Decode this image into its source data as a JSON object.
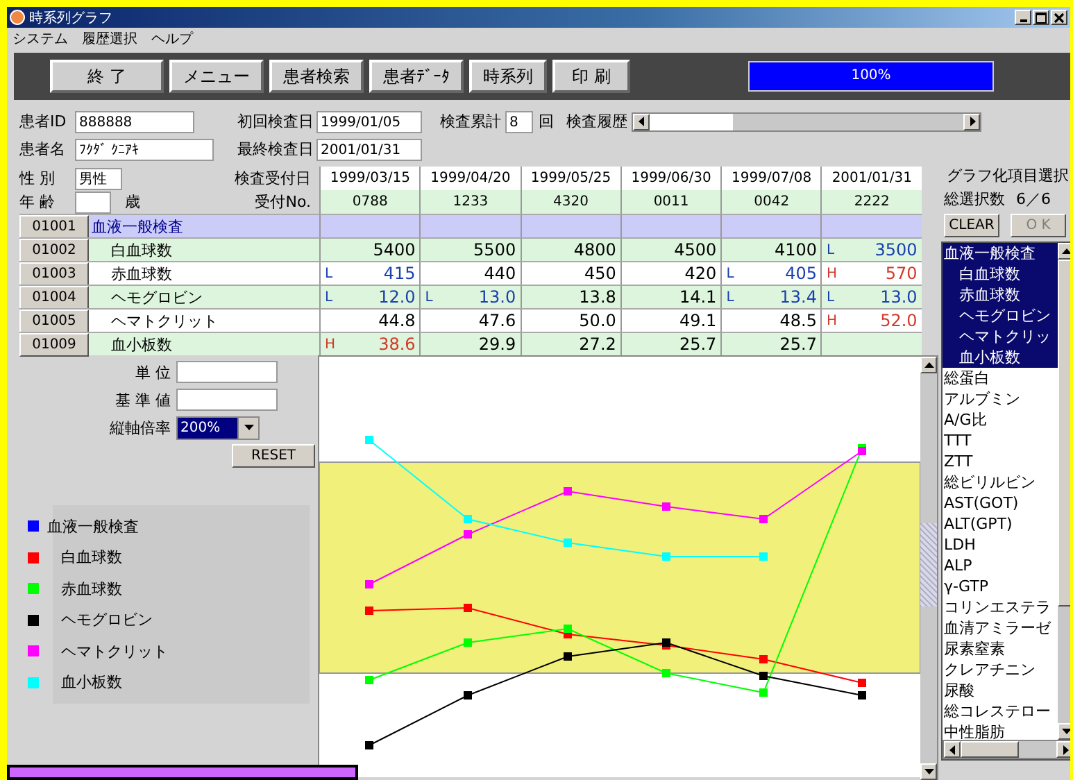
{
  "window": {
    "title": "時系列グラフ"
  },
  "menu": [
    "システム",
    "履歴選択",
    "ヘルプ"
  ],
  "toolbar": {
    "buttons": [
      "終 了",
      "メニュー",
      "患者検索",
      "患者ﾃﾞｰﾀ",
      "時系列",
      "印 刷"
    ],
    "progress": {
      "level": 1,
      "label": "100%"
    }
  },
  "patient": {
    "id_label": "患者ID",
    "id": "888888",
    "name_label": "患者名",
    "name": "ﾌｸﾀﾞ ｸﾆｱｷ",
    "first_label": "初回検査日",
    "first": "1999/01/05",
    "last_label": "最終検査日",
    "last": "2001/01/31",
    "count_label": "検査累計",
    "count": "8",
    "count_unit": "回",
    "history_label": "検査履歴",
    "sex_label": "性 別",
    "sex": "男性",
    "age_label": "年 齢",
    "age_unit": "歳"
  },
  "table": {
    "date_label": "検査受付日",
    "number_label": "受付No.",
    "columns": [
      {
        "date": "1999/03/15",
        "number": "0788"
      },
      {
        "date": "1999/04/20",
        "number": "1233"
      },
      {
        "date": "1999/05/25",
        "number": "4320"
      },
      {
        "date": "1999/06/30",
        "number": "0011"
      },
      {
        "date": "1999/07/08",
        "number": "0042"
      },
      {
        "date": "2001/01/31",
        "number": "2222"
      }
    ],
    "rows": [
      {
        "code": "01001",
        "name": "血液一般検査",
        "kind": "group",
        "cells": []
      },
      {
        "code": "01002",
        "name": "白血球数",
        "kind": "item",
        "cells": [
          {
            "value": "5400",
            "color": "#000000"
          },
          {
            "value": "5500",
            "color": "#000000"
          },
          {
            "value": "4800",
            "color": "#000000"
          },
          {
            "value": "4500",
            "color": "#000000"
          },
          {
            "value": "4100",
            "color": "#000000"
          },
          {
            "flag": "L",
            "value": "3500",
            "color": "#1a3fb0"
          }
        ]
      },
      {
        "code": "01003",
        "name": "赤血球数",
        "kind": "item",
        "cells": [
          {
            "flag": "L",
            "value": "415",
            "color": "#1a3fb0"
          },
          {
            "value": "440",
            "color": "#000000"
          },
          {
            "value": "450",
            "color": "#000000"
          },
          {
            "value": "420",
            "color": "#000000"
          },
          {
            "flag": "L",
            "value": "405",
            "color": "#1a3fb0"
          },
          {
            "flag": "H",
            "value": "570",
            "color": "#d23a2a"
          }
        ]
      },
      {
        "code": "01004",
        "name": "ヘモグロビン",
        "kind": "item",
        "cells": [
          {
            "flag": "L",
            "value": "12.0",
            "color": "#1a3fb0"
          },
          {
            "flag": "L",
            "value": "13.0",
            "color": "#1a3fb0"
          },
          {
            "value": "13.8",
            "color": "#000000"
          },
          {
            "value": "14.1",
            "color": "#000000"
          },
          {
            "flag": "L",
            "value": "13.4",
            "color": "#1a3fb0"
          },
          {
            "flag": "L",
            "value": "13.0",
            "color": "#1a3fb0"
          }
        ]
      },
      {
        "code": "01005",
        "name": "ヘマトクリット",
        "kind": "item",
        "cells": [
          {
            "value": "44.8",
            "color": "#000000"
          },
          {
            "value": "47.6",
            "color": "#000000"
          },
          {
            "value": "50.0",
            "color": "#000000"
          },
          {
            "value": "49.1",
            "color": "#000000"
          },
          {
            "value": "48.5",
            "color": "#000000"
          },
          {
            "flag": "H",
            "value": "52.0",
            "color": "#d23a2a"
          }
        ]
      },
      {
        "code": "01009",
        "name": "血小板数",
        "kind": "item",
        "cells": [
          {
            "flag": "H",
            "value": "38.6",
            "color": "#d23a2a"
          },
          {
            "value": "29.9",
            "color": "#000000"
          },
          {
            "value": "27.2",
            "color": "#000000"
          },
          {
            "value": "25.7",
            "color": "#000000"
          },
          {
            "value": "25.7",
            "color": "#000000"
          }
        ]
      }
    ]
  },
  "settings": {
    "unit_label": "単 位",
    "reference_label": "基 準 値",
    "scale_label": "縦軸倍率",
    "scale": "200%",
    "reset": "RESET"
  },
  "legend": [
    {
      "name": "血液一般検査",
      "color": "#0000ff",
      "children": [
        {
          "name": "白血球数",
          "color": "#ff0000"
        },
        {
          "name": "赤血球数",
          "color": "#00ff00"
        },
        {
          "name": "ヘモグロビン",
          "color": "#000000"
        },
        {
          "name": "ヘマトクリット",
          "color": "#ff00ff"
        },
        {
          "name": "血小板数",
          "color": "#00ffff"
        }
      ]
    }
  ],
  "selector": {
    "title": "グラフ化項目選択",
    "count_label": "総選択数",
    "count": "6／6",
    "clear": "CLEAR",
    "ok": {
      "label": "O K",
      "disabled": true
    },
    "items": [
      {
        "name": "血液一般検査",
        "selected": true,
        "children": [
          {
            "name": "白血球数",
            "selected": true
          },
          {
            "name": "赤血球数",
            "selected": true
          },
          {
            "name": "ヘモグロビン",
            "selected": true
          },
          {
            "name": "ヘマトクリッ",
            "selected": true
          },
          {
            "name": "血小板数",
            "selected": true
          }
        ]
      },
      {
        "name": "総蛋白",
        "selected": false
      },
      {
        "name": "アルブミン",
        "selected": false
      },
      {
        "name": "A/G比",
        "selected": false
      },
      {
        "name": "TTT",
        "selected": false
      },
      {
        "name": "ZTT",
        "selected": false
      },
      {
        "name": "総ビリルビン",
        "selected": false
      },
      {
        "name": "AST(GOT)",
        "selected": false
      },
      {
        "name": "ALT(GPT)",
        "selected": false
      },
      {
        "name": "LDH",
        "selected": false
      },
      {
        "name": "ALP",
        "selected": false
      },
      {
        "name": "γ-GTP",
        "selected": false
      },
      {
        "name": "コリンエステラ",
        "selected": false
      },
      {
        "name": "血清アミラーゼ",
        "selected": false
      },
      {
        "name": "尿素窒素",
        "selected": false
      },
      {
        "name": "クレアチニン",
        "selected": false
      },
      {
        "name": "尿酸",
        "selected": false
      },
      {
        "name": "総コレステロー",
        "selected": false
      },
      {
        "name": "中性脂肪",
        "selected": false
      }
    ]
  }
}
